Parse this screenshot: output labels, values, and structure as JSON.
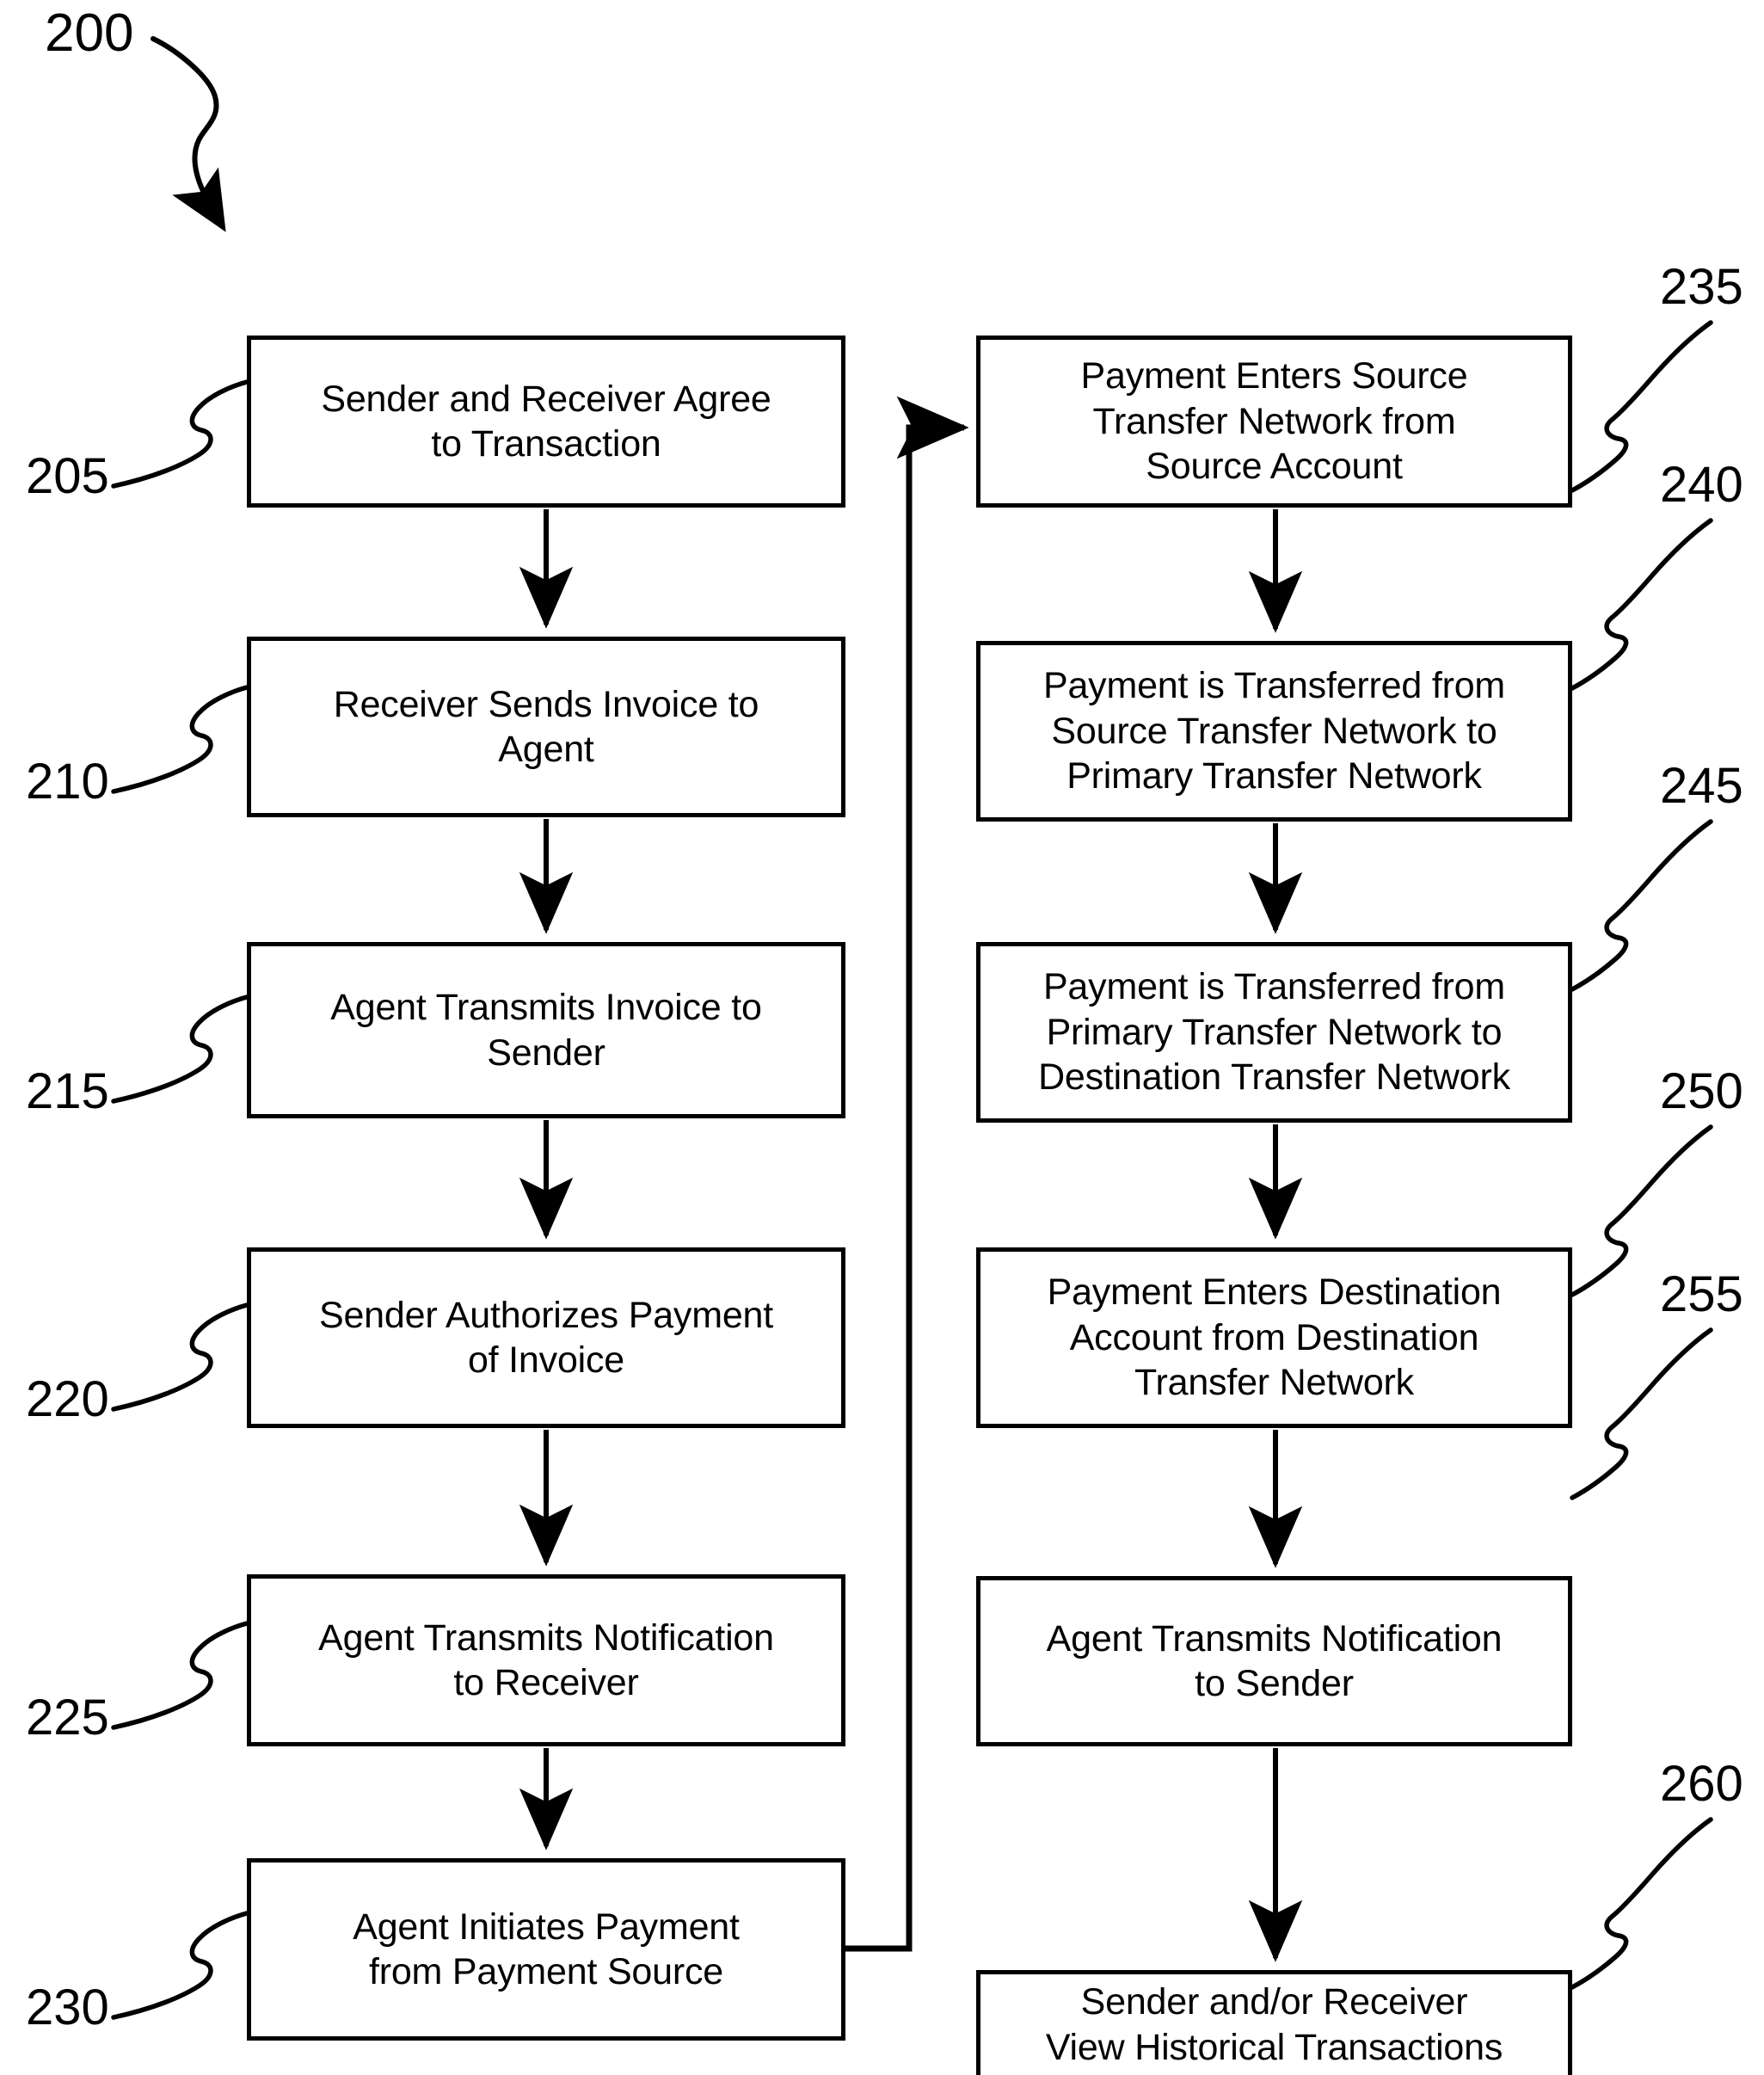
{
  "figure": {
    "number": "200",
    "title": "Payment transaction flow diagram",
    "ink_color": "#000000",
    "background_color": "#ffffff"
  },
  "left_column": {
    "steps": [
      {
        "ref": "205",
        "label": "Sender and Receiver Agree\nto Transaction"
      },
      {
        "ref": "210",
        "label": "Receiver Sends Invoice to\nAgent"
      },
      {
        "ref": "215",
        "label": "Agent Transmits Invoice to\nSender"
      },
      {
        "ref": "220",
        "label": "Sender Authorizes Payment\nof Invoice"
      },
      {
        "ref": "225",
        "label": "Agent Transmits Notification\nto Receiver"
      },
      {
        "ref": "230",
        "label": "Agent Initiates Payment\nfrom Payment Source"
      }
    ]
  },
  "right_column": {
    "steps": [
      {
        "ref": "235",
        "label": "Payment Enters Source\nTransfer Network from\nSource Account"
      },
      {
        "ref": "240",
        "label": "Payment is Transferred from\nSource Transfer Network to\nPrimary Transfer Network"
      },
      {
        "ref": "245",
        "label": "Payment is Transferred from\nPrimary Transfer Network to\nDestination Transfer Network"
      },
      {
        "ref": "250",
        "label": "Payment Enters Destination\nAccount from Destination\nTransfer Network"
      },
      {
        "ref": "255",
        "label": "Agent Transmits Notification\nto Sender"
      },
      {
        "ref": "260",
        "label": "Sender and/or Receiver\nView Historical Transactions"
      }
    ]
  },
  "connections": [
    {
      "from": "205",
      "to": "210",
      "kind": "vertical-arrow"
    },
    {
      "from": "210",
      "to": "215",
      "kind": "vertical-arrow"
    },
    {
      "from": "215",
      "to": "220",
      "kind": "vertical-arrow"
    },
    {
      "from": "220",
      "to": "225",
      "kind": "vertical-arrow"
    },
    {
      "from": "225",
      "to": "230",
      "kind": "vertical-arrow"
    },
    {
      "from": "230",
      "to": "235",
      "kind": "routed-arrow-right-up"
    },
    {
      "from": "235",
      "to": "240",
      "kind": "vertical-arrow"
    },
    {
      "from": "240",
      "to": "245",
      "kind": "vertical-arrow"
    },
    {
      "from": "245",
      "to": "250",
      "kind": "vertical-arrow"
    },
    {
      "from": "250",
      "to": "255",
      "kind": "vertical-arrow"
    },
    {
      "from": "255",
      "to": "260",
      "kind": "vertical-arrow"
    }
  ]
}
